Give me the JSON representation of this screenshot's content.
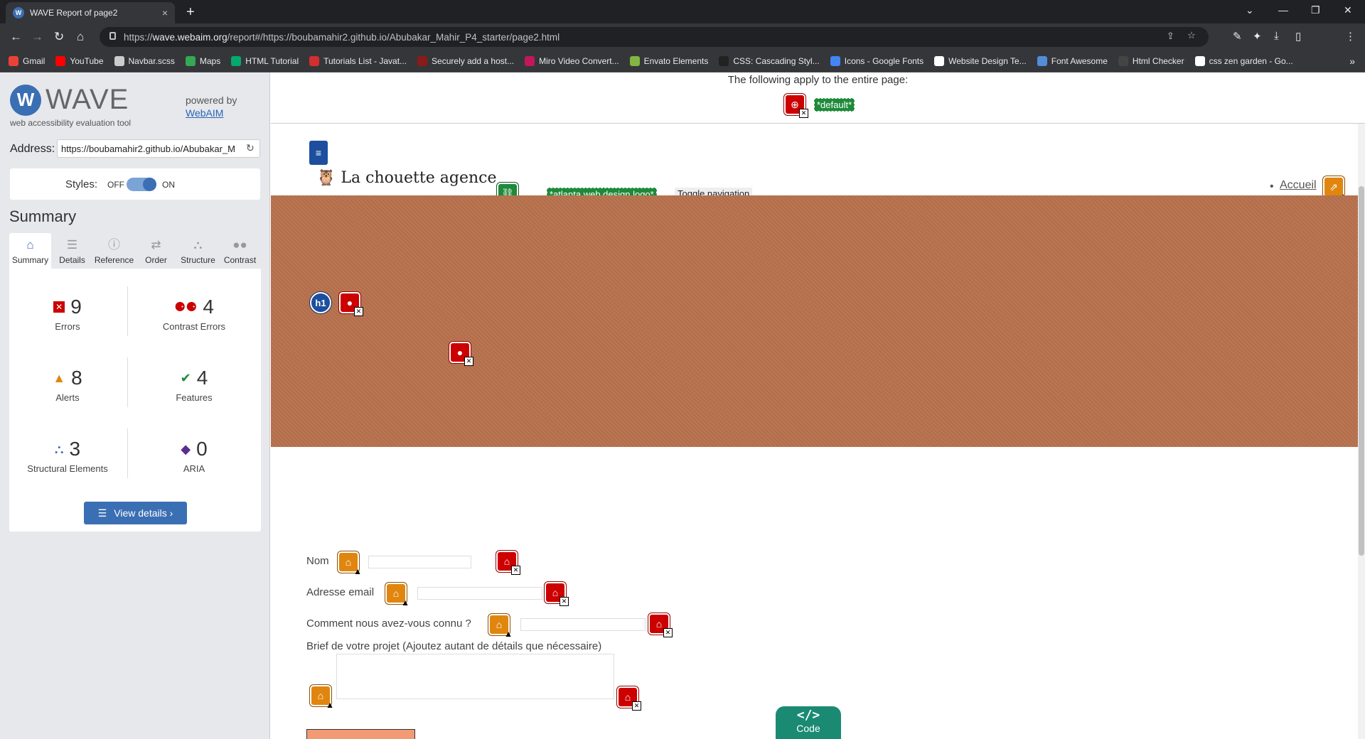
{
  "browser": {
    "tab_title": "WAVE Report of page2",
    "tab_close": "×",
    "new_tab": "+",
    "url_prefix": "https://",
    "url_host": "wave.webaim.org",
    "url_rest": "/report#/https://boubamahir2.github.io/Abubakar_Mahir_P4_starter/page2.html",
    "bookmarks": [
      {
        "label": "Gmail",
        "color": "#ea4335"
      },
      {
        "label": "YouTube",
        "color": "#ff0000"
      },
      {
        "label": "Navbar.scss",
        "color": "#cccccc"
      },
      {
        "label": "Maps",
        "color": "#34a853"
      },
      {
        "label": "HTML Tutorial",
        "color": "#04aa6d"
      },
      {
        "label": "Tutorials List - Javat...",
        "color": "#d32f2f"
      },
      {
        "label": "Securely add a host...",
        "color": "#8b1a1a"
      },
      {
        "label": "Miro Video Convert...",
        "color": "#c2185b"
      },
      {
        "label": "Envato Elements",
        "color": "#82b541"
      },
      {
        "label": "CSS: Cascading Styl...",
        "color": "#222222"
      },
      {
        "label": "Icons - Google Fonts",
        "color": "#4285f4"
      },
      {
        "label": "Website Design Te...",
        "color": "#ffffff"
      },
      {
        "label": "Font Awesome",
        "color": "#528dd7"
      },
      {
        "label": "Html Checker",
        "color": "#444444"
      },
      {
        "label": "css zen garden - Go...",
        "color": "#ffffff"
      }
    ],
    "bookmarks_more": "»"
  },
  "wave": {
    "logo_letter": "W",
    "logo_word": "WAVE",
    "subtitle": "web accessibility evaluation tool",
    "powered_by": "powered by",
    "webaim_link": "WebAIM",
    "address_label": "Address:",
    "address_value": "https://boubamahir2.github.io/Abubakar_M",
    "styles_label": "Styles:",
    "styles_off": "OFF",
    "styles_on": "ON",
    "summary_title": "Summary",
    "tabs": [
      {
        "label": "Summary",
        "icon": "home-icon"
      },
      {
        "label": "Details",
        "icon": "list-icon"
      },
      {
        "label": "Reference",
        "icon": "info-icon"
      },
      {
        "label": "Order",
        "icon": "order-icon"
      },
      {
        "label": "Structure",
        "icon": "structure-icon"
      },
      {
        "label": "Contrast",
        "icon": "contrast-icon"
      }
    ],
    "stats": {
      "errors": {
        "count": "9",
        "label": "Errors"
      },
      "contrast_errors": {
        "count": "4",
        "label": "Contrast Errors"
      },
      "alerts": {
        "count": "8",
        "label": "Alerts"
      },
      "features": {
        "count": "4",
        "label": "Features"
      },
      "structural": {
        "count": "3",
        "label": "Structural Elements"
      },
      "aria": {
        "count": "0",
        "label": "ARIA"
      }
    },
    "view_details": "View details ›"
  },
  "page": {
    "apply_text": "The following apply to the entire page:",
    "default_label": "*default*",
    "site_name": "La chouette agence",
    "logo_alt_label": "*atlanta web design logo*",
    "toggle_nav": "Toggle navigation",
    "nav_accueil": "Accueil",
    "h1_badge": "h1",
    "form": {
      "nom": "Nom",
      "email": "Adresse email",
      "source": "Comment nous avez-vous connu ?",
      "brief": "Brief de votre projet (Ajoutez autant de détails que nécessaire)"
    },
    "code_label": "Code",
    "code_icon": "</>"
  },
  "colors": {
    "wave_blue": "#3b6fb3",
    "error_red": "#c00000",
    "alert_orange": "#e0860f",
    "feature_green": "#1f8a3a",
    "brick": "#b8714d"
  }
}
